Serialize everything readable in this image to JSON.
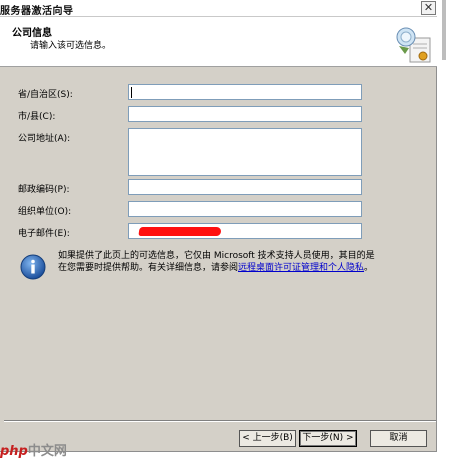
{
  "window": {
    "title": "服务器激活向导",
    "close_glyph": "✕"
  },
  "header": {
    "title": "公司信息",
    "subtitle": "请输入该可选信息。",
    "icon": "wizard-certificate-icon"
  },
  "form": {
    "fields": [
      {
        "label": "省/自治区(S):",
        "value": ""
      },
      {
        "label": "市/县(C):",
        "value": ""
      },
      {
        "label": "公司地址(A):",
        "value": ""
      },
      {
        "label": "邮政编码(P):",
        "value": ""
      },
      {
        "label": "组织单位(O):",
        "value": ""
      },
      {
        "label": "电子邮件(E):",
        "value": ""
      }
    ]
  },
  "info": {
    "icon": "info-icon",
    "text": "如果提供了此页上的可选信息，它仅由 Microsoft 技术支持人员使用，其目的是在您需要时提供帮助。有关详细信息，请参阅",
    "link": "远程桌面许可证管理和个人隐私",
    "suffix": "。"
  },
  "buttons": {
    "back": "< 上一步(B)",
    "next": "下一步(N) >",
    "cancel": "取消"
  },
  "watermark": {
    "prefix": "php",
    "brand": "中文网"
  },
  "colors": {
    "dialog_bg": "#d4d0c8",
    "link": "#0000cc",
    "redaction": "#ff1010"
  }
}
